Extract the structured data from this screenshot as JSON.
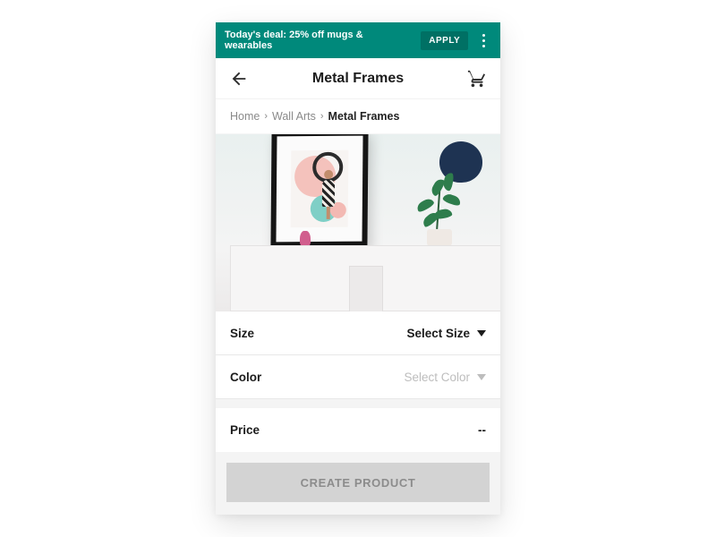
{
  "banner": {
    "text": "Today's deal: 25% off mugs & wearables",
    "apply_label": "APPLY"
  },
  "topbar": {
    "title": "Metal Frames"
  },
  "breadcrumb": {
    "items": [
      "Home",
      "Wall Arts",
      "Metal Frames"
    ]
  },
  "options": {
    "size": {
      "label": "Size",
      "value": "Select Size",
      "enabled": true
    },
    "color": {
      "label": "Color",
      "value": "Select Color",
      "enabled": false
    },
    "price": {
      "label": "Price",
      "value": "--"
    }
  },
  "cta": {
    "label": "CREATE PRODUCT",
    "enabled": false
  },
  "colors": {
    "accent": "#00897b"
  }
}
